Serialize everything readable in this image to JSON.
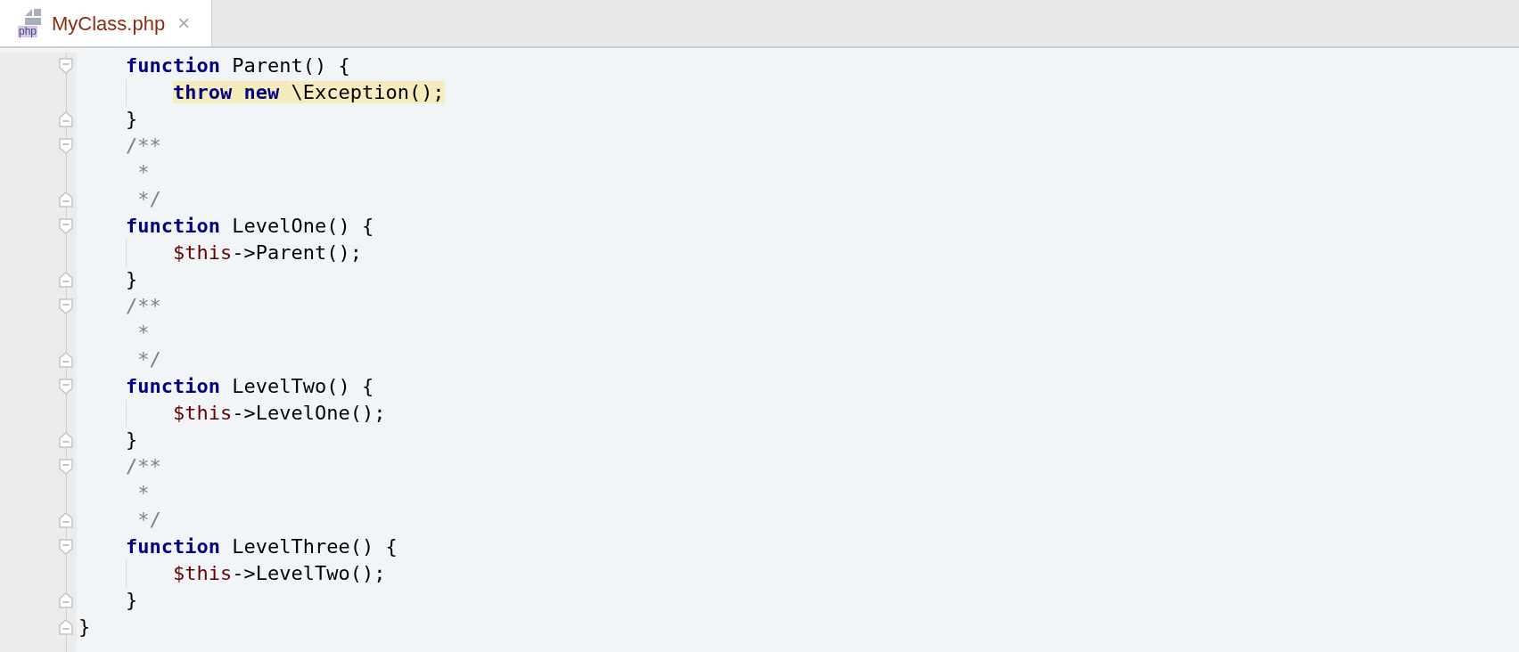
{
  "tab": {
    "title": "MyClass.php",
    "icon_label": "php",
    "close": "×",
    "selected": true
  },
  "lines": [
    {
      "kind": "fold-start",
      "highlighted": false,
      "tokens": [
        {
          "kind": "keyword",
          "text": "    function"
        },
        {
          "kind": "plain",
          "text": " Parent() {"
        }
      ]
    },
    {
      "kind": "body",
      "highlighted": true,
      "tokens": [
        {
          "kind": "keyword",
          "text": "        throw new"
        },
        {
          "kind": "plain",
          "text": " \\Exception();"
        }
      ]
    },
    {
      "kind": "fold-end",
      "highlighted": false,
      "tokens": [
        {
          "kind": "plain",
          "text": "    }"
        }
      ]
    },
    {
      "kind": "fold-start",
      "highlighted": false,
      "tokens": [
        {
          "kind": "comment",
          "text": "    /**"
        }
      ]
    },
    {
      "kind": "body",
      "highlighted": false,
      "tokens": [
        {
          "kind": "comment",
          "text": "     *"
        }
      ]
    },
    {
      "kind": "fold-end",
      "highlighted": false,
      "tokens": [
        {
          "kind": "comment",
          "text": "     */"
        }
      ]
    },
    {
      "kind": "fold-start",
      "highlighted": false,
      "tokens": [
        {
          "kind": "keyword",
          "text": "    function"
        },
        {
          "kind": "plain",
          "text": " LevelOne() {"
        }
      ]
    },
    {
      "kind": "body",
      "highlighted": false,
      "tokens": [
        {
          "kind": "variable",
          "text": "        $this"
        },
        {
          "kind": "plain",
          "text": "->Parent();"
        }
      ]
    },
    {
      "kind": "fold-end",
      "highlighted": false,
      "tokens": [
        {
          "kind": "plain",
          "text": "    }"
        }
      ]
    },
    {
      "kind": "fold-start",
      "highlighted": false,
      "tokens": [
        {
          "kind": "comment",
          "text": "    /**"
        }
      ]
    },
    {
      "kind": "body",
      "highlighted": false,
      "tokens": [
        {
          "kind": "comment",
          "text": "     *"
        }
      ]
    },
    {
      "kind": "fold-end",
      "highlighted": false,
      "tokens": [
        {
          "kind": "comment",
          "text": "     */"
        }
      ]
    },
    {
      "kind": "fold-start",
      "highlighted": false,
      "tokens": [
        {
          "kind": "keyword",
          "text": "    function"
        },
        {
          "kind": "plain",
          "text": " LevelTwo() {"
        }
      ]
    },
    {
      "kind": "body",
      "highlighted": false,
      "tokens": [
        {
          "kind": "variable",
          "text": "        $this"
        },
        {
          "kind": "plain",
          "text": "->LevelOne();"
        }
      ]
    },
    {
      "kind": "fold-end",
      "highlighted": false,
      "tokens": [
        {
          "kind": "plain",
          "text": "    }"
        }
      ]
    },
    {
      "kind": "fold-start",
      "highlighted": false,
      "tokens": [
        {
          "kind": "comment",
          "text": "    /**"
        }
      ]
    },
    {
      "kind": "body",
      "highlighted": false,
      "tokens": [
        {
          "kind": "comment",
          "text": "     *"
        }
      ]
    },
    {
      "kind": "fold-end",
      "highlighted": false,
      "tokens": [
        {
          "kind": "comment",
          "text": "     */"
        }
      ]
    },
    {
      "kind": "fold-start",
      "highlighted": false,
      "tokens": [
        {
          "kind": "keyword",
          "text": "    function"
        },
        {
          "kind": "plain",
          "text": " LevelThree() {"
        }
      ]
    },
    {
      "kind": "body",
      "highlighted": false,
      "tokens": [
        {
          "kind": "variable",
          "text": "        $this"
        },
        {
          "kind": "plain",
          "text": "->LevelTwo();"
        }
      ]
    },
    {
      "kind": "fold-end",
      "highlighted": false,
      "tokens": [
        {
          "kind": "plain",
          "text": "    }"
        }
      ]
    },
    {
      "kind": "fold-end",
      "highlighted": false,
      "tokens": [
        {
          "kind": "plain",
          "text": "}"
        }
      ]
    }
  ]
}
